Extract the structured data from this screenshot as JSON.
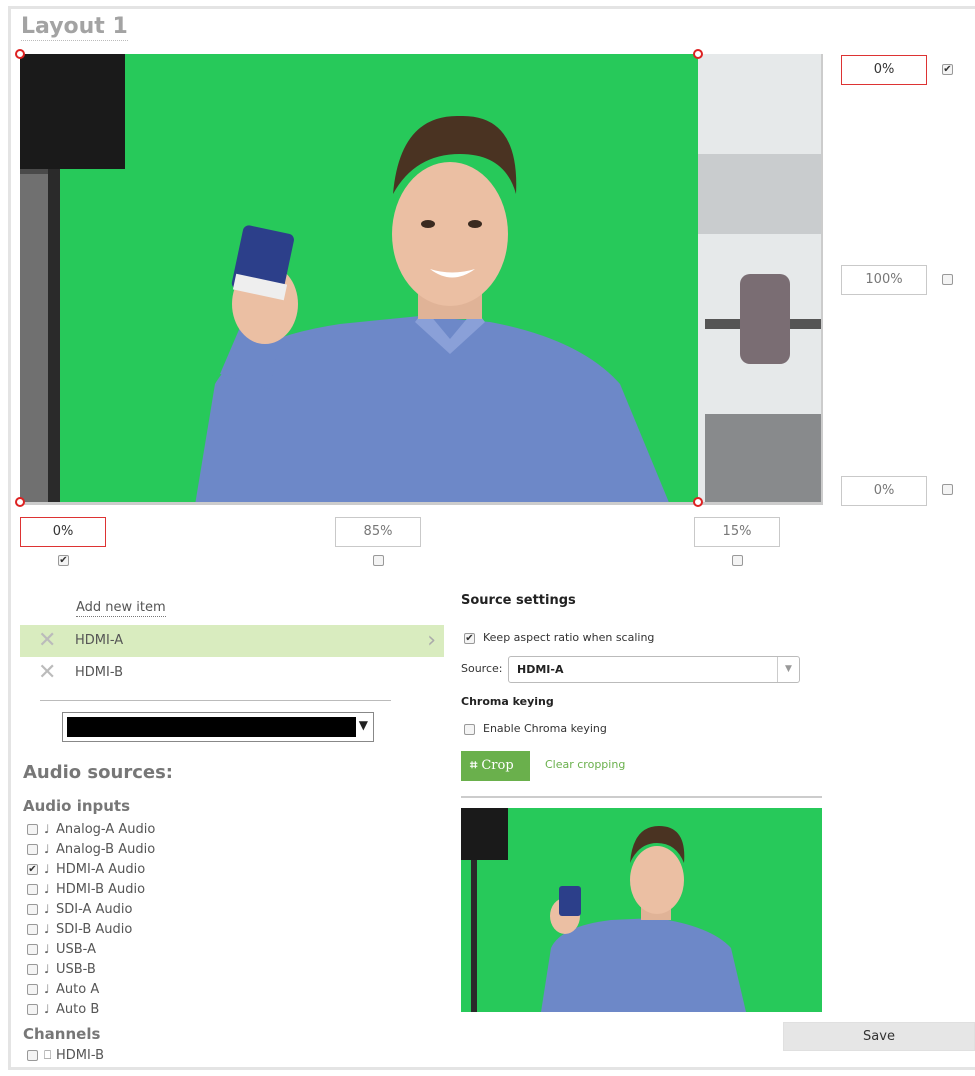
{
  "layout": {
    "title": "Layout 1"
  },
  "canvas": {
    "right_inputs": [
      {
        "value": "0%",
        "checked": true
      },
      {
        "value": "100%",
        "checked": false
      },
      {
        "value": "0%",
        "checked": false
      }
    ],
    "bottom_inputs": [
      {
        "value": "0%",
        "checked": true
      },
      {
        "value": "85%",
        "checked": false
      },
      {
        "value": "15%",
        "checked": false
      }
    ]
  },
  "sources": {
    "add_new_item": "Add new item",
    "items": [
      {
        "label": "HDMI-A",
        "selected": true
      },
      {
        "label": "HDMI-B",
        "selected": false
      }
    ],
    "background_color": "#000000"
  },
  "audio": {
    "heading": "Audio sources:",
    "inputs_heading": "Audio inputs",
    "inputs": [
      {
        "label": "Analog-A Audio",
        "checked": false
      },
      {
        "label": "Analog-B Audio",
        "checked": false
      },
      {
        "label": "HDMI-A Audio",
        "checked": true
      },
      {
        "label": "HDMI-B Audio",
        "checked": false
      },
      {
        "label": "SDI-A Audio",
        "checked": false
      },
      {
        "label": "SDI-B Audio",
        "checked": false
      },
      {
        "label": "USB-A",
        "checked": false
      },
      {
        "label": "USB-B",
        "checked": false
      },
      {
        "label": "Auto A",
        "checked": false
      },
      {
        "label": "Auto B",
        "checked": false
      }
    ],
    "channels_heading": "Channels",
    "channels": [
      {
        "label": "HDMI-B",
        "checked": false
      }
    ]
  },
  "source_settings": {
    "title": "Source settings",
    "keep_aspect_label": "Keep aspect ratio when scaling",
    "keep_aspect_checked": true,
    "source_label": "Source:",
    "source_value": "HDMI-A",
    "chroma_title": "Chroma keying",
    "enable_chroma_label": "Enable Chroma keying",
    "enable_chroma_checked": false,
    "crop_label": "Crop",
    "clear_cropping_label": "Clear cropping"
  },
  "save_label": "Save",
  "colors": {
    "accent": "#6ab04c",
    "selected_row": "#d9ecbf",
    "error_border": "#dd3333",
    "green_screen": "#27c95a"
  }
}
